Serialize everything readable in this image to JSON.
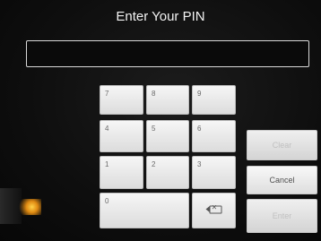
{
  "title": "Enter Your PIN",
  "pin_field": {
    "value": ""
  },
  "keypad": {
    "k7": "7",
    "k8": "8",
    "k9": "9",
    "k4": "4",
    "k5": "5",
    "k6": "6",
    "k1": "1",
    "k2": "2",
    "k3": "3",
    "k0": "0",
    "backspace_icon": "backspace-icon"
  },
  "side_buttons": {
    "clear": "Clear",
    "cancel": "Cancel",
    "enter": "Enter"
  },
  "colors": {
    "background": "#0b0b0b",
    "key_face": "#e8e8e8",
    "disabled_text": "#c0c0c0"
  }
}
